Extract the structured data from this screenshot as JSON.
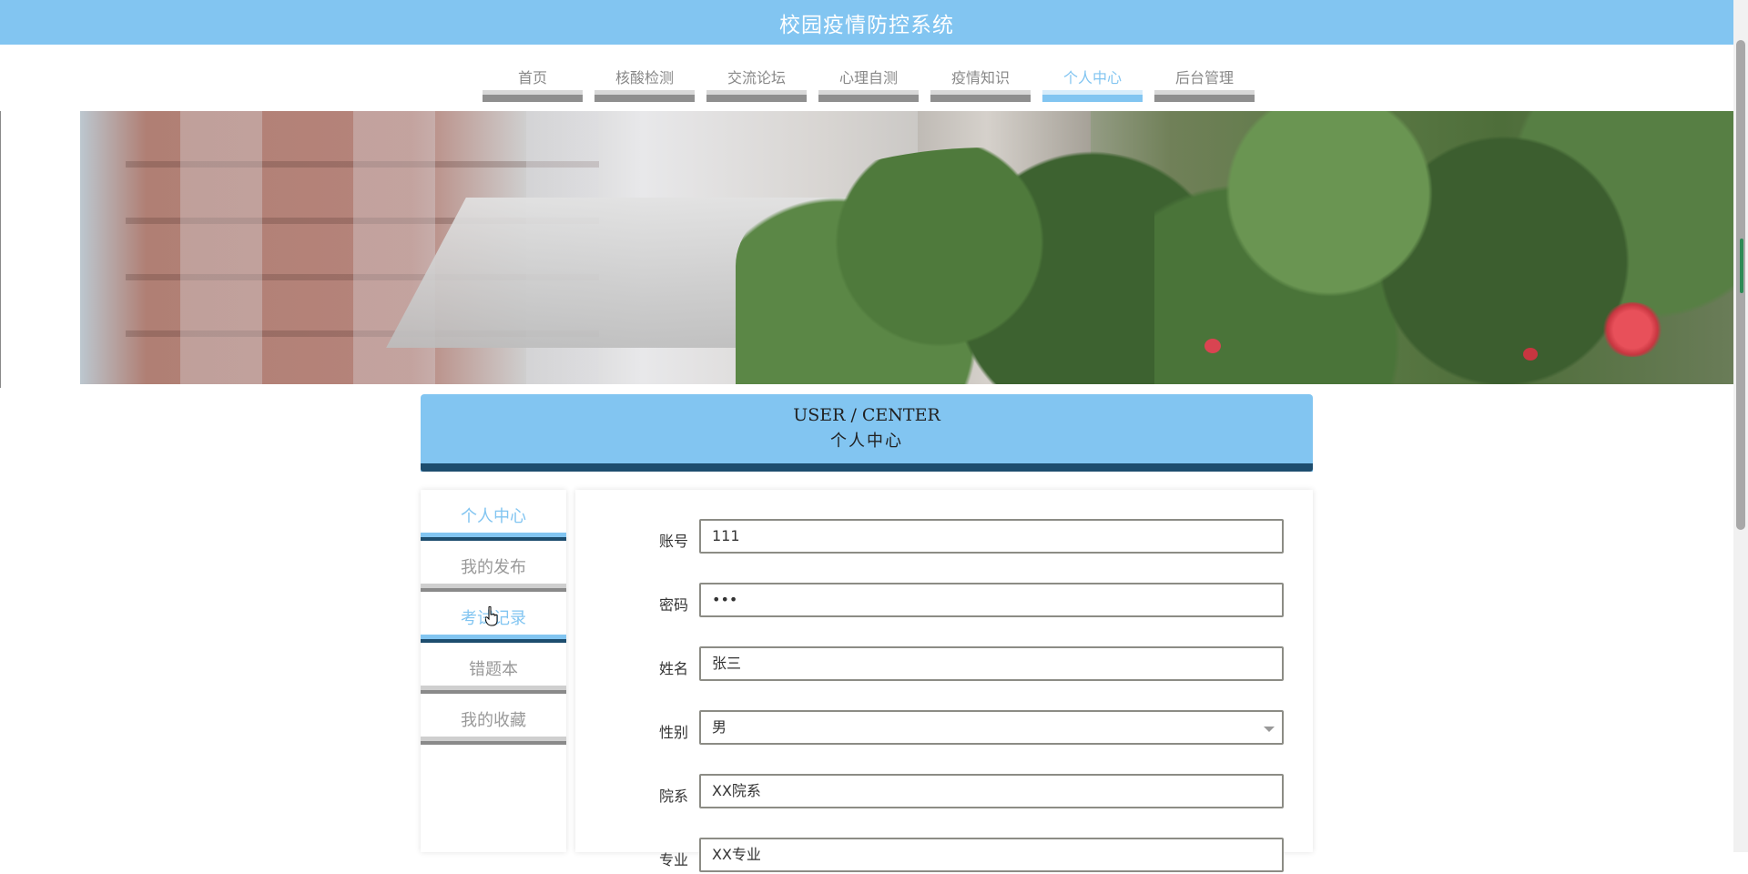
{
  "header": {
    "title": "校园疫情防控系统"
  },
  "nav": {
    "items": [
      {
        "label": "首页"
      },
      {
        "label": "核酸检测"
      },
      {
        "label": "交流论坛"
      },
      {
        "label": "心理自测"
      },
      {
        "label": "疫情知识"
      },
      {
        "label": "个人中心"
      },
      {
        "label": "后台管理"
      }
    ],
    "active": "个人中心"
  },
  "page_header": {
    "en": "USER / CENTER",
    "cn": "个人中心"
  },
  "sidebar": {
    "items": [
      {
        "label": "个人中心"
      },
      {
        "label": "我的发布"
      },
      {
        "label": "考试记录"
      },
      {
        "label": "错题本"
      },
      {
        "label": "我的收藏"
      }
    ]
  },
  "form": {
    "fields": [
      {
        "label": "账号",
        "value": "111"
      },
      {
        "label": "密码",
        "value": "•••"
      },
      {
        "label": "姓名",
        "value": "张三"
      },
      {
        "label": "性别",
        "value": "男"
      },
      {
        "label": "院系",
        "value": "XX院系"
      },
      {
        "label": "专业",
        "value": "XX专业"
      }
    ]
  },
  "colors": {
    "accent": "#82c5f1",
    "dark_accent": "#1d4d6e",
    "nav_inactive": "#888888"
  },
  "icons": {
    "cursor": "hand-pointer-icon",
    "select": "chevron-down-icon"
  }
}
